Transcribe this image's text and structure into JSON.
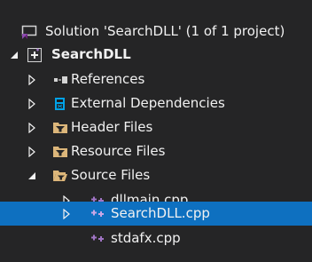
{
  "tree": {
    "solution": {
      "label": "Solution 'SearchDLL' (1 of 1 project)",
      "icon": "solution-icon"
    },
    "project": {
      "label": "SearchDLL",
      "icon": "cpp-project-icon"
    },
    "references": {
      "label": "References",
      "icon": "references-icon"
    },
    "external_dependencies": {
      "label": "External Dependencies",
      "icon": "external-dependencies-icon"
    },
    "header_files": {
      "label": "Header Files",
      "icon": "filter-folder-icon"
    },
    "resource_files": {
      "label": "Resource Files",
      "icon": "filter-folder-icon"
    },
    "source_files": {
      "label": "Source Files",
      "icon": "filter-folder-open-icon"
    },
    "files": [
      {
        "label": "dllmain.cpp",
        "icon": "cpp-file-icon"
      },
      {
        "label": "SearchDLL.cpp",
        "icon": "cpp-file-icon",
        "selected": true
      },
      {
        "label": "stdafx.cpp",
        "icon": "cpp-file-icon"
      }
    ]
  },
  "colors": {
    "background": "#252526",
    "text": "#f1f1f1",
    "selection": "#0e70c0",
    "folder": "#dcb67a",
    "cpp": "#a074c4",
    "solution": "#68217a",
    "external_dependencies": "#00a2e8"
  }
}
